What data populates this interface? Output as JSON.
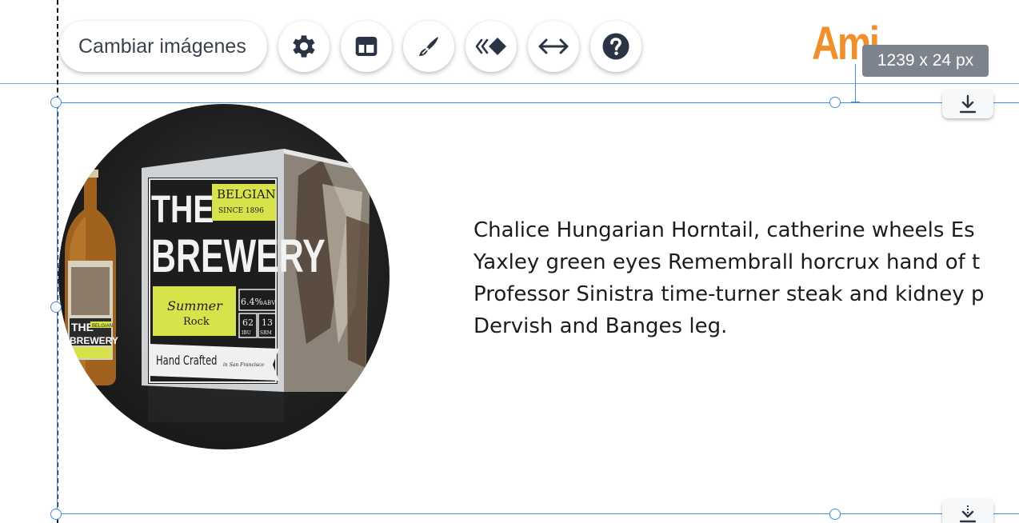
{
  "toolbar": {
    "change_images_label": "Cambiar imágenes",
    "icons": [
      "gear-icon",
      "layout-icon",
      "brush-icon",
      "animation-icon",
      "stretch-icon",
      "help-icon"
    ]
  },
  "logo_fragment": "Ami",
  "size_tooltip": "1239 x 24 px",
  "image": {
    "box_words": [
      "THE",
      "BREWERY"
    ],
    "belgian": "BELGIAN",
    "since": "SINCE 1896",
    "summer": "Summer",
    "rock": "Rock",
    "abv_value": "6.4%",
    "abv_label": "ABV",
    "ibu_value": "62",
    "ibu_label": "IBU",
    "srm_value": "13",
    "srm_label": "SRM",
    "hand_crafted": "Hand Crafted",
    "in_sf": "in San Francisco",
    "bottle_the": "THE",
    "bottle_brewery": "BREWERY",
    "bottle_belgian": "BELGIAN"
  },
  "paragraph": {
    "lines": [
      " Chalice Hungarian Horntail, catherine wheels Es",
      "Yaxley green eyes Remembrall horcrux hand of t",
      "Professor Sinistra time-turner steak and kidney p",
      "Dervish and Banges leg."
    ]
  },
  "colors": {
    "selection": "#3f8ce6",
    "logo": "#f0902c",
    "tooltip_bg": "#7c838c",
    "icon": "#2b3445",
    "label_yellow": "#d8e24a"
  }
}
